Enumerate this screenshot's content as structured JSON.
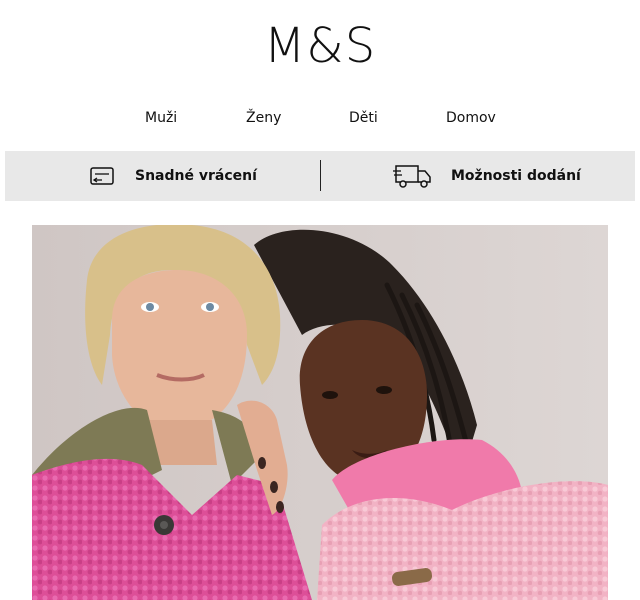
{
  "brand": {
    "logo_text": "M&S"
  },
  "nav": {
    "items": [
      {
        "label": "Muži"
      },
      {
        "label": "Ženy"
      },
      {
        "label": "Děti"
      },
      {
        "label": "Domov"
      }
    ]
  },
  "service_bar": {
    "returns": {
      "label": "Snadné vrácení",
      "icon": "returns-package-icon"
    },
    "delivery": {
      "label": "Možnosti dodání",
      "icon": "delivery-truck-icon"
    }
  },
  "hero": {
    "image": "two-models-pink-teddy-coats"
  },
  "colors": {
    "service_bar_bg": "#e8e8e8",
    "coat_left": "#e0579e",
    "coat_right": "#f3b8c8"
  }
}
